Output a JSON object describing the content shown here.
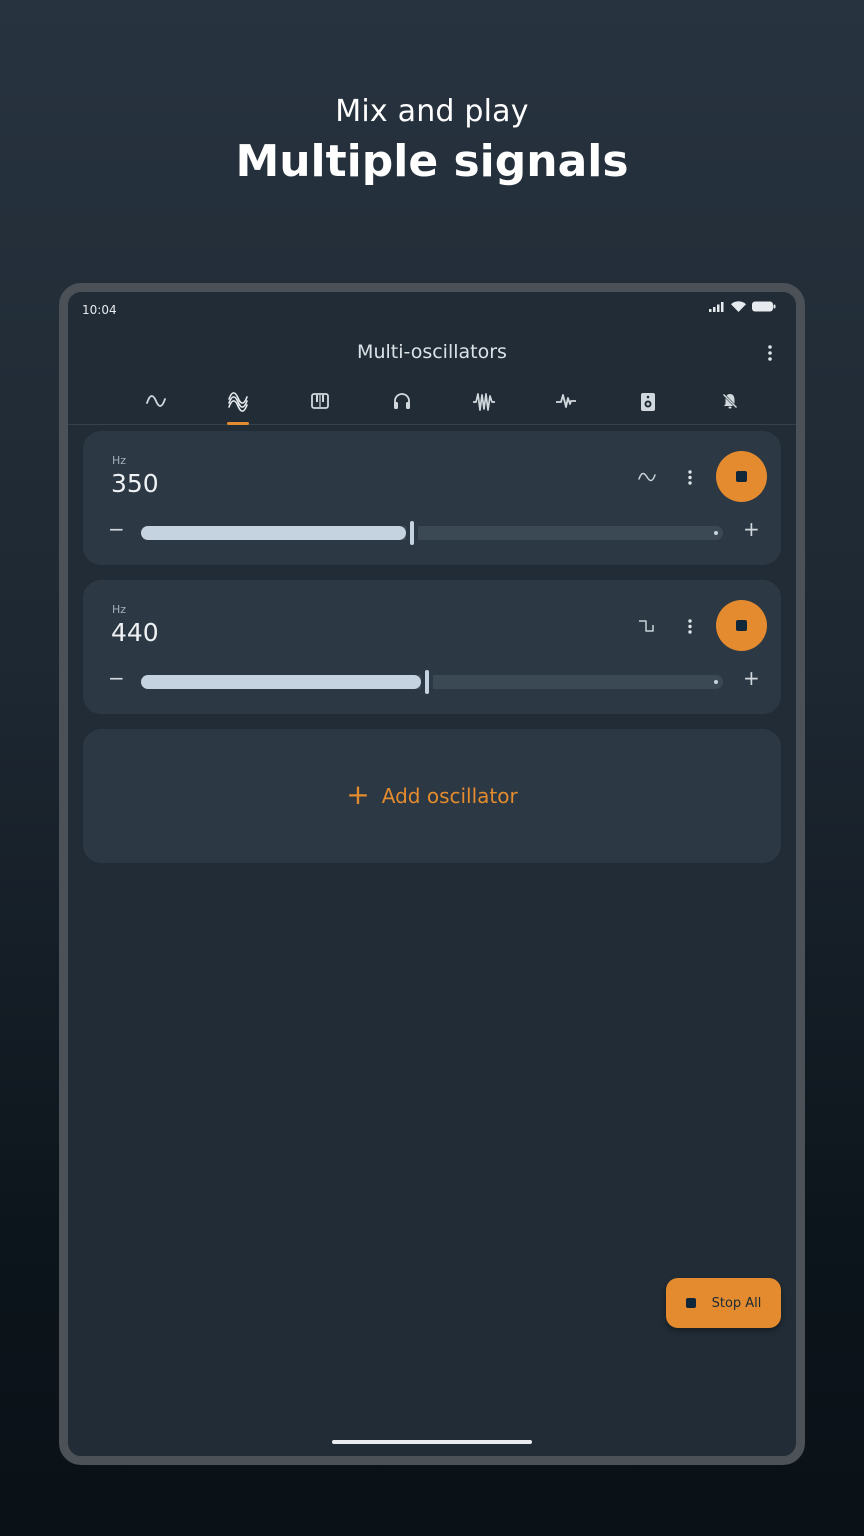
{
  "promo": {
    "subtitle": "Mix and play",
    "title": "Multiple signals"
  },
  "status_bar": {
    "time": "10:04",
    "icons": [
      "signal-icon",
      "wifi-icon",
      "battery-icon"
    ]
  },
  "app_bar": {
    "title": "Multi-oscillators",
    "menu_icon": "more-vert-icon"
  },
  "tabs": [
    {
      "icon": "sine-wave-icon",
      "active": false
    },
    {
      "icon": "multi-oscillator-icon",
      "active": true
    },
    {
      "icon": "piano-icon",
      "active": false
    },
    {
      "icon": "headphones-icon",
      "active": false
    },
    {
      "icon": "noise-icon",
      "active": false
    },
    {
      "icon": "sweep-icon",
      "active": false
    },
    {
      "icon": "speaker-icon",
      "active": false
    },
    {
      "icon": "mute-bell-icon",
      "active": false
    }
  ],
  "oscillators": [
    {
      "unit": "Hz",
      "frequency": "350",
      "waveform": "sine",
      "waveform_icon": "sine-wave-icon",
      "slider_fraction": 0.465,
      "minus": "−",
      "plus": "+",
      "playing": true
    },
    {
      "unit": "Hz",
      "frequency": "440",
      "waveform": "square",
      "waveform_icon": "square-wave-icon",
      "slider_fraction": 0.492,
      "minus": "−",
      "plus": "+",
      "playing": true
    }
  ],
  "add_oscillator": {
    "icon": "+",
    "label": "Add oscillator"
  },
  "fab": {
    "label": "Stop All"
  },
  "colors": {
    "accent": "#e38b2e",
    "card": "#2c3843",
    "screen": "#212c36",
    "slider_fill": "#c5d3e1"
  }
}
